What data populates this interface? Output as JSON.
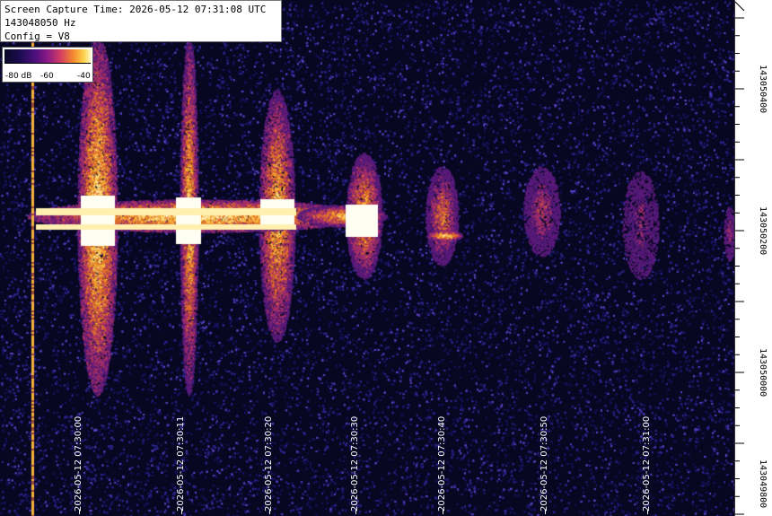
{
  "header": {
    "capture_time": "Screen Capture Time: 2026-05-12 07:31:08 UTC",
    "frequency": "143048050 Hz",
    "config": "Config = V8"
  },
  "colorbar": {
    "labels": [
      "-80 dB",
      "-60",
      "-40"
    ]
  },
  "freq_axis": {
    "labels": [
      "143050400",
      "143050200",
      "143050000",
      "143049800"
    ]
  },
  "time_axis": {
    "labels": [
      "2026-05-12 07:30:00",
      "2026-05-12 07:30:11",
      "2026-05-12 07:30:20",
      "2026-05-12 07:30:30",
      "2026-05-12 07:30:40",
      "2026-05-12 07:30:50",
      "2026-05-12 07:31:00"
    ]
  },
  "colors": {
    "background": "#0b0b3a",
    "noise": "#3a2a9a",
    "signal_hot": "#fff6c8",
    "signal_warm": "#f7a32a"
  }
}
